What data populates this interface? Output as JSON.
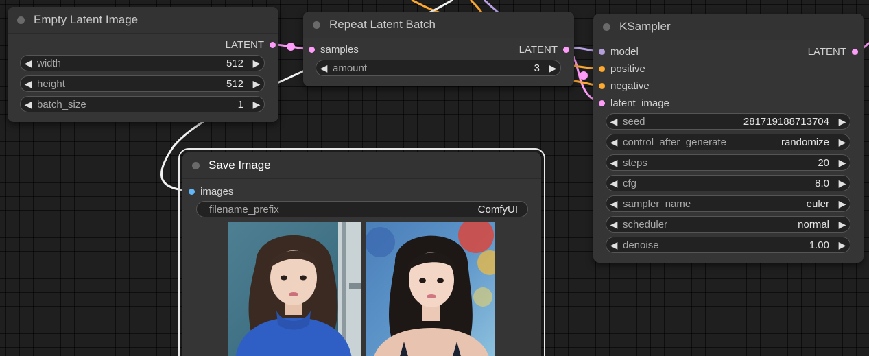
{
  "colors": {
    "latent": "#ff9cf9",
    "model": "#b39ddb",
    "conditioning": "#ffa931",
    "image": "#64b5f6",
    "link_white": "#f2f2f2",
    "link_purple": "#b9a3e6"
  },
  "nodes": {
    "empty_latent": {
      "title": "Empty Latent Image",
      "output": "LATENT",
      "widgets": [
        {
          "name": "width",
          "value": "512"
        },
        {
          "name": "height",
          "value": "512"
        },
        {
          "name": "batch_size",
          "value": "1"
        }
      ]
    },
    "repeat_latent": {
      "title": "Repeat Latent Batch",
      "input": "samples",
      "output": "LATENT",
      "widgets": [
        {
          "name": "amount",
          "value": "3"
        }
      ]
    },
    "ksampler": {
      "title": "KSampler",
      "inputs": [
        "model",
        "positive",
        "negative",
        "latent_image"
      ],
      "output": "LATENT",
      "widgets": [
        {
          "name": "seed",
          "value": "281719188713704"
        },
        {
          "name": "control_after_generate",
          "value": "randomize"
        },
        {
          "name": "steps",
          "value": "20"
        },
        {
          "name": "cfg",
          "value": "8.0"
        },
        {
          "name": "sampler_name",
          "value": "euler"
        },
        {
          "name": "scheduler",
          "value": "normal"
        },
        {
          "name": "denoise",
          "value": "1.00"
        }
      ]
    },
    "save_image": {
      "title": "Save Image",
      "input": "images",
      "widgets": [
        {
          "name": "filename_prefix",
          "value": "ComfyUI"
        }
      ]
    }
  },
  "icons": {
    "arrow_left": "◀",
    "arrow_right": "▶"
  }
}
